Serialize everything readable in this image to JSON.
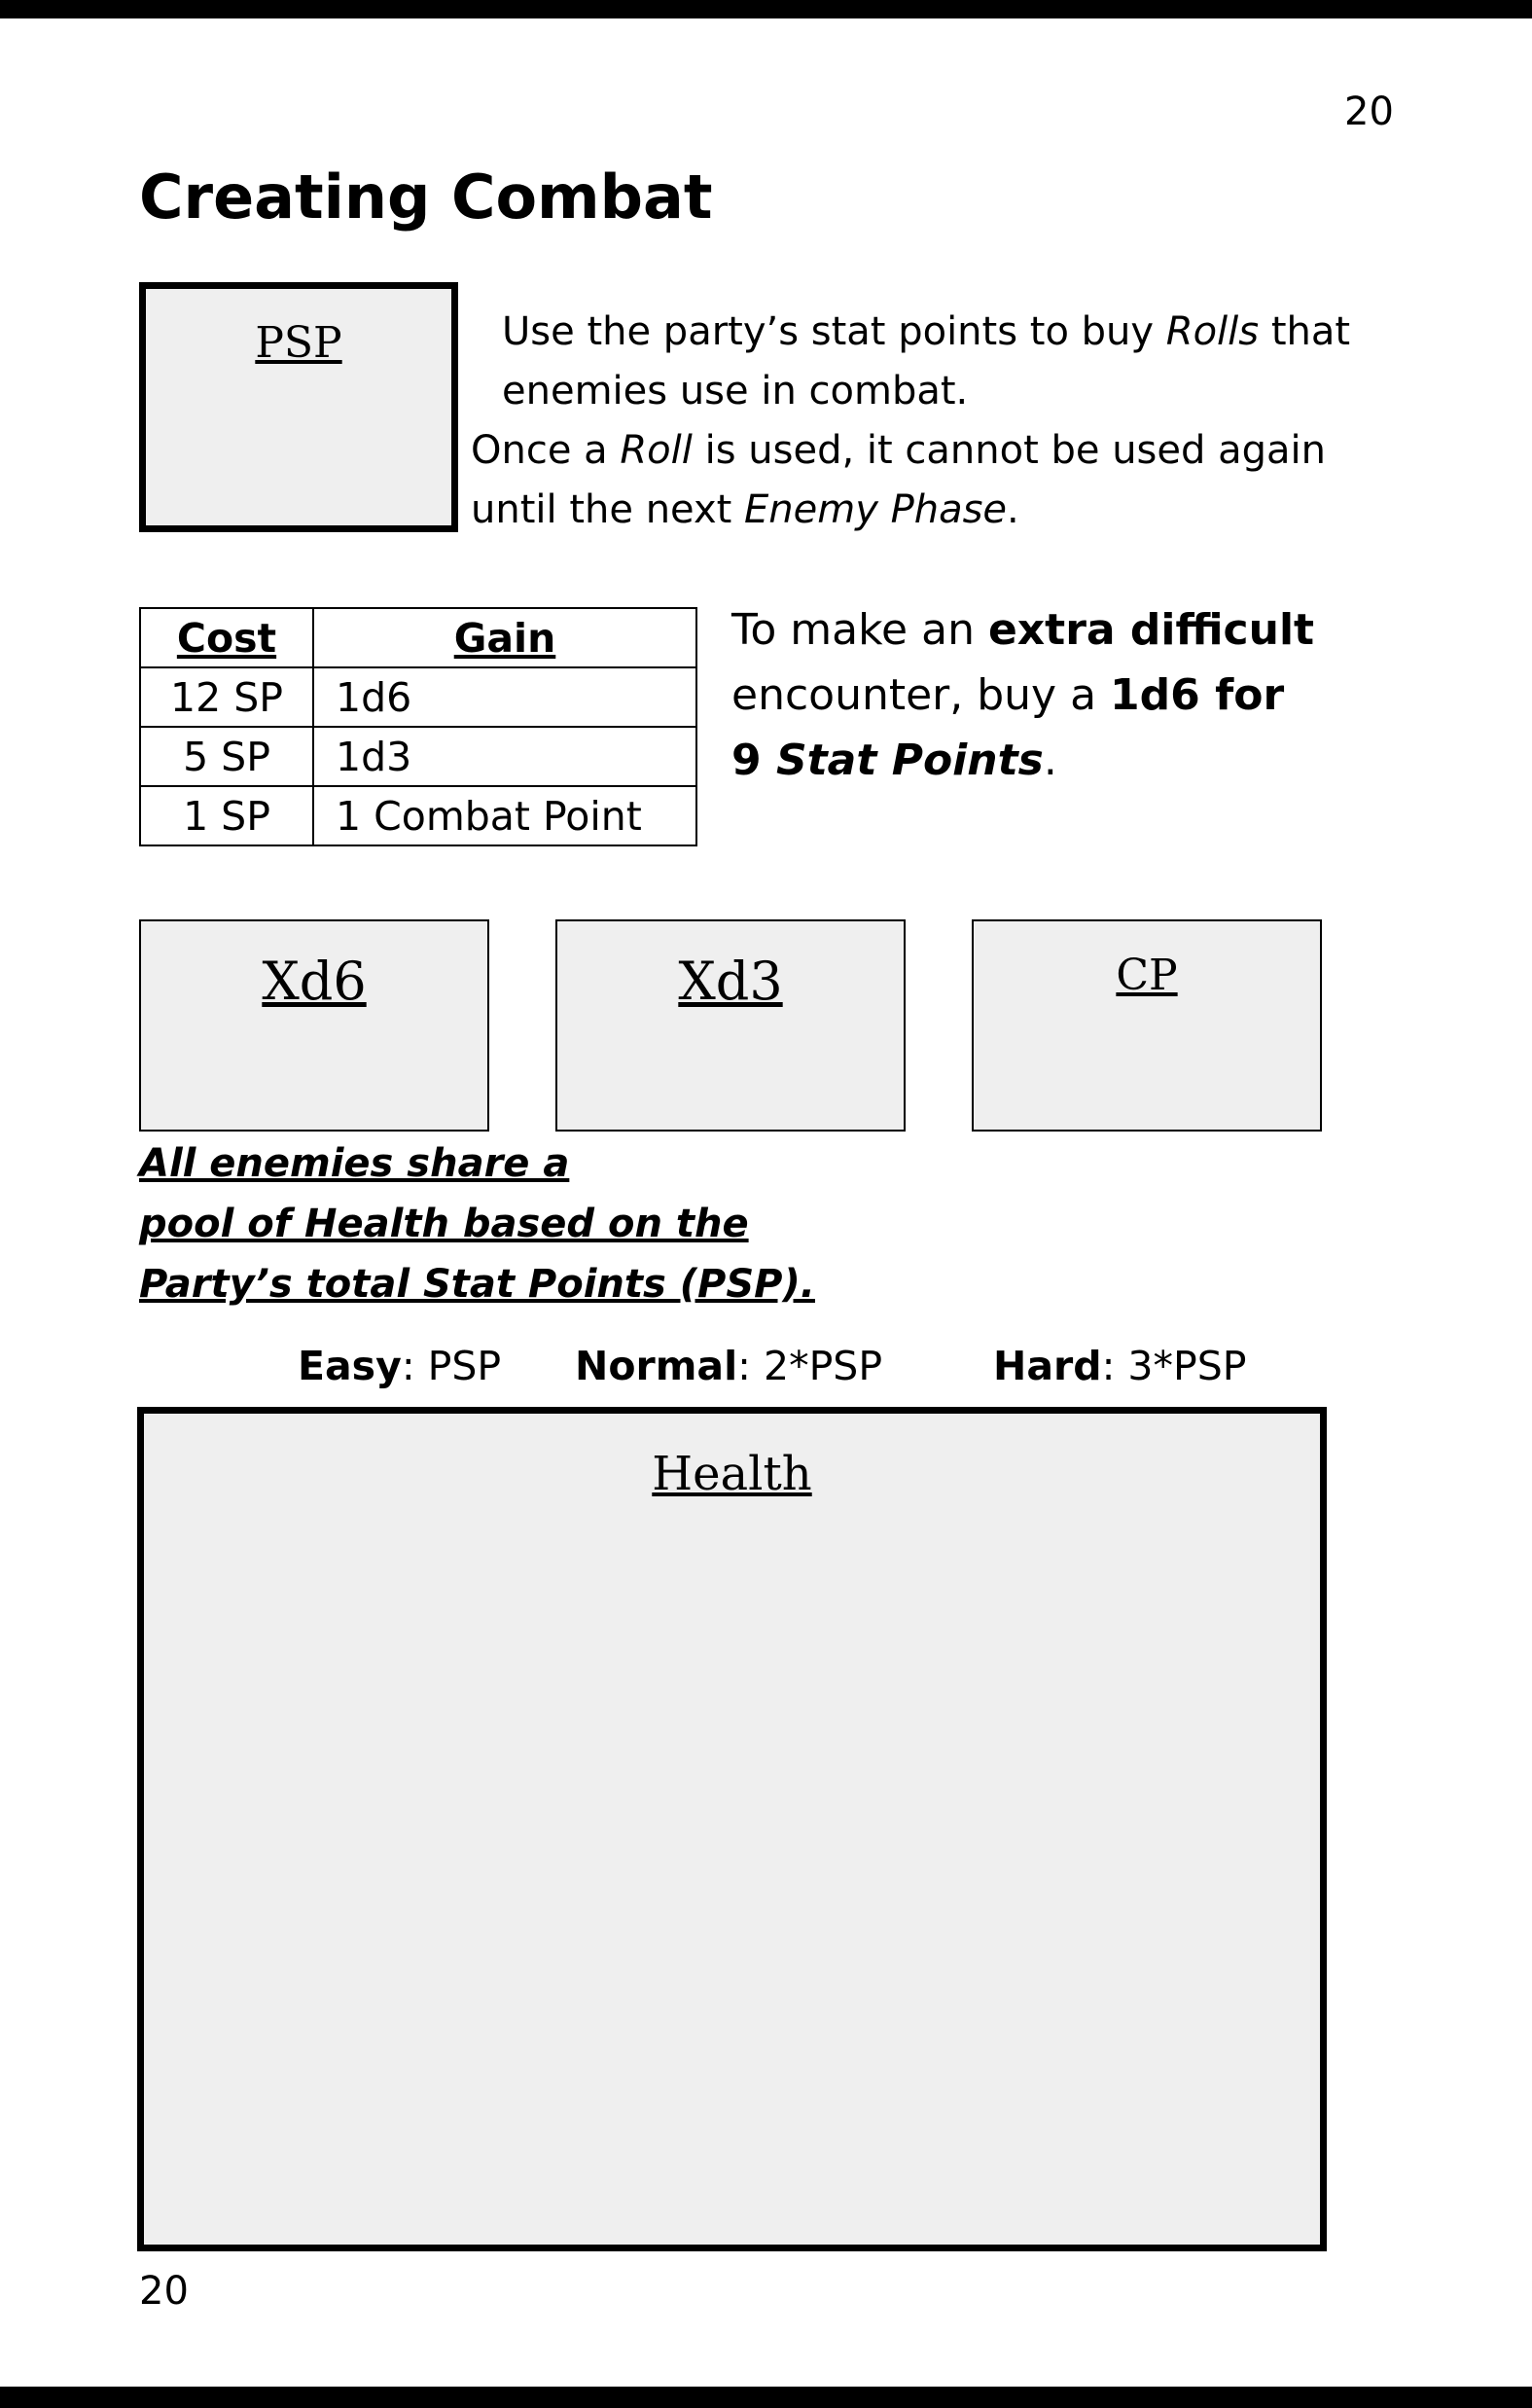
{
  "page": {
    "number_top": "20",
    "number_bottom": "20",
    "title": "Creating Combat"
  },
  "psp_box": {
    "label": "PSP"
  },
  "intro": {
    "line1_a": "Use the party’s stat points to buy ",
    "line1_em": "Rolls",
    "line1_b": " that enemies use in combat.",
    "line2_a": "Once a ",
    "line2_em": "Roll",
    "line2_b": " is used, it cannot be used again until the next ",
    "line2_em2": "Enemy Phase",
    "line2_c": "."
  },
  "cost_table": {
    "headers": [
      "Cost",
      "Gain"
    ],
    "rows": [
      [
        "12 SP",
        "1d6"
      ],
      [
        "5 SP",
        "1d3"
      ],
      [
        "1 SP",
        "1 Combat Point"
      ]
    ]
  },
  "extra": {
    "a": "To make an ",
    "b": "extra difficult",
    "c": " encounter, buy a ",
    "d": "1d6 for",
    "e": "9 ",
    "f": "Stat Points",
    "g": "."
  },
  "roll_boxes": [
    "Xd6",
    "Xd3",
    "CP"
  ],
  "shared_note": {
    "line1": "All enemies share a",
    "line2": "pool of Health based on the",
    "line3": "Party’s total Stat Points (PSP)."
  },
  "difficulty": {
    "easy_label": "Easy",
    "easy_value": ": PSP",
    "normal_label": "Normal",
    "normal_value": ": 2*PSP",
    "hard_label": "Hard",
    "hard_value": ": 3*PSP"
  },
  "health_box": {
    "label": "Health"
  }
}
